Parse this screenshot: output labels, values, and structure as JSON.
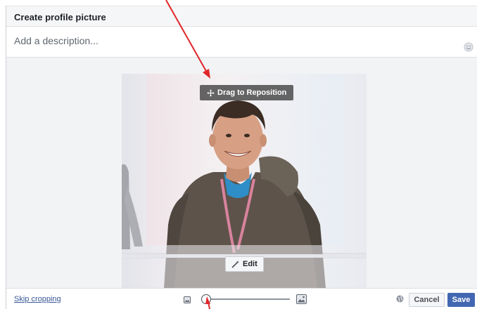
{
  "dialog": {
    "title": "Create profile picture",
    "description": {
      "value": "",
      "placeholder": "Add a description..."
    }
  },
  "photo": {
    "drag_hint": "Drag to Reposition",
    "edit_label": "Edit"
  },
  "footer": {
    "skip_label": "Skip cropping",
    "zoom_level": 0.0,
    "cancel_label": "Cancel",
    "save_label": "Save"
  },
  "icons": {
    "emoji": "emoji-icon",
    "move": "move-icon",
    "wand": "magic-wand-icon",
    "image_small": "image-small-icon",
    "image_large": "image-large-icon",
    "globe": "globe-icon"
  },
  "colors": {
    "link": "#385898",
    "primary_button": "#4267b2",
    "annotation_arrow": "#e0262a"
  }
}
